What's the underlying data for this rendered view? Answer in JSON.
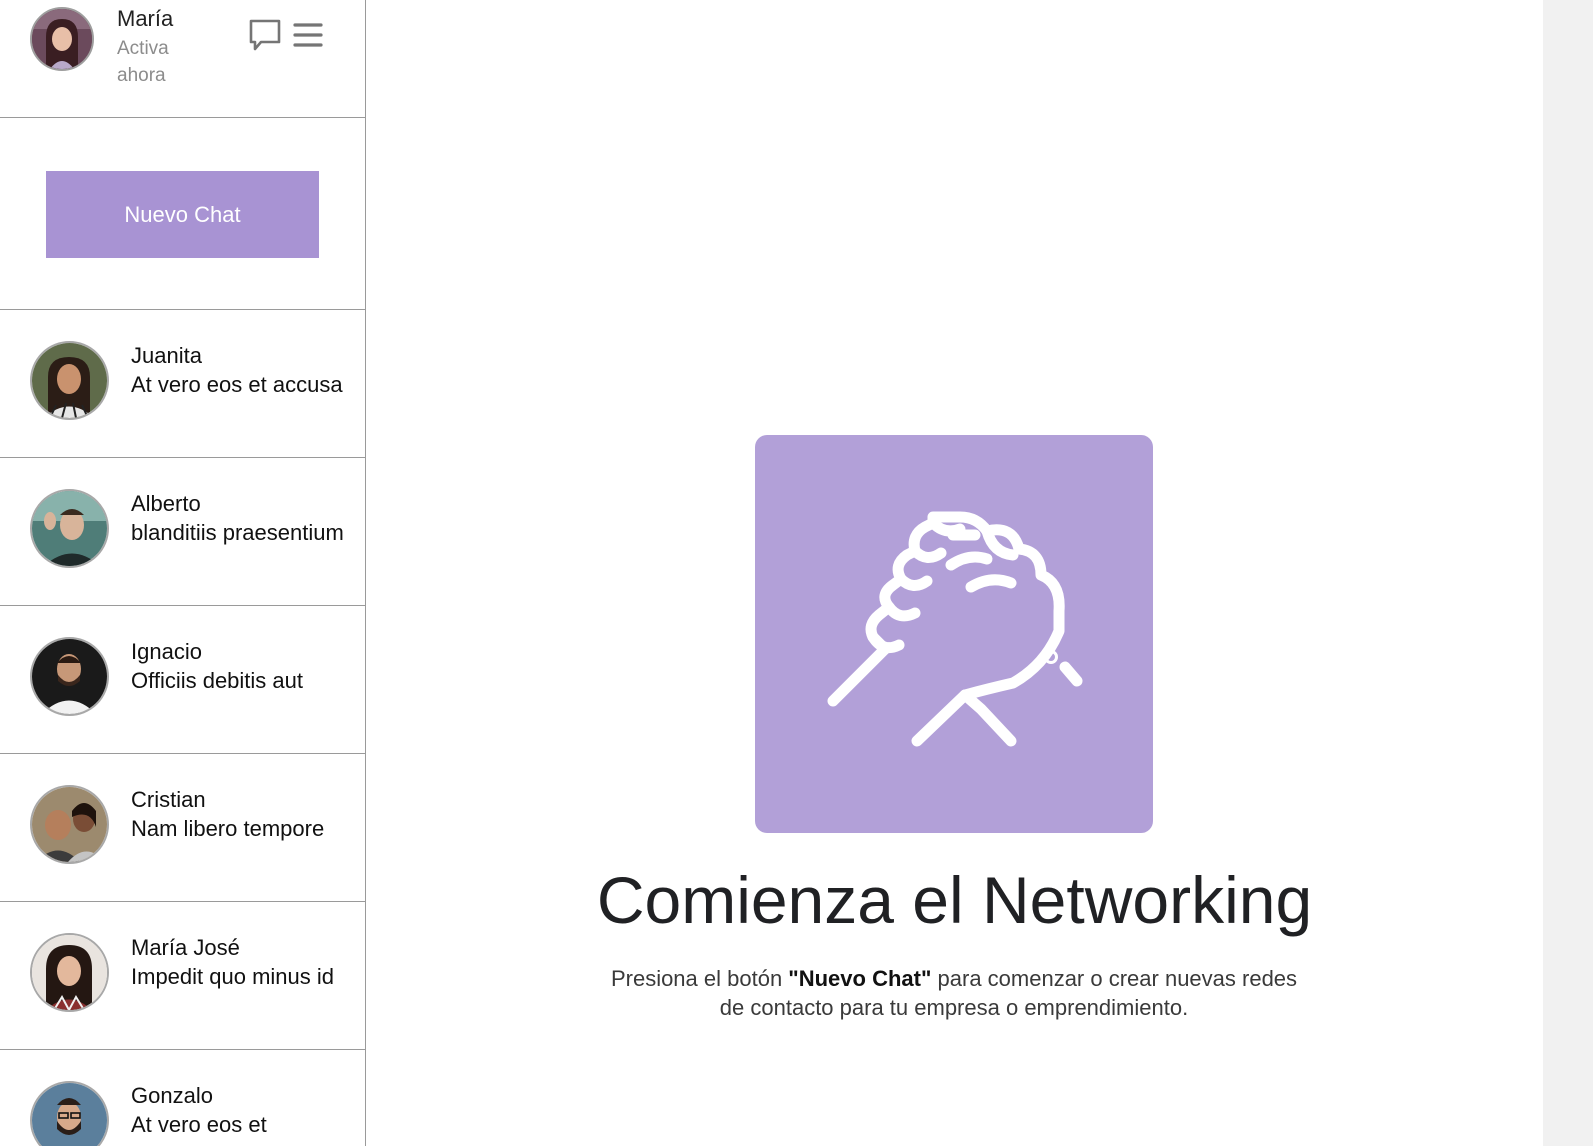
{
  "profile": {
    "name": "María",
    "status": "Activa ahora",
    "avatar_icon": "user-avatar-maria"
  },
  "header_icons": {
    "chat_icon": "speech-bubble-icon",
    "menu_icon": "hamburger-menu-icon"
  },
  "new_chat": {
    "label": "Nuevo Chat",
    "color": "#a893d3"
  },
  "contacts": [
    {
      "name": "Juanita",
      "message": "At vero eos et accusa"
    },
    {
      "name": "Alberto",
      "message": "blanditiis praesentium"
    },
    {
      "name": "Ignacio",
      "message": "Officiis debitis aut"
    },
    {
      "name": "Cristian",
      "message": "Nam libero tempore"
    },
    {
      "name": "María José",
      "message": "Impedit quo minus id"
    },
    {
      "name": "Gonzalo",
      "message": "At vero eos et"
    }
  ],
  "main": {
    "illustration_icon": "handshake-icon",
    "tile_color": "#b2a0d8",
    "title": "Comienza el Networking",
    "description_pre": "Presiona el botón ",
    "description_bold": "\"Nuevo Chat\"",
    "description_post": " para comenzar o crear nuevas redes de contacto para tu empresa o emprendimiento."
  }
}
